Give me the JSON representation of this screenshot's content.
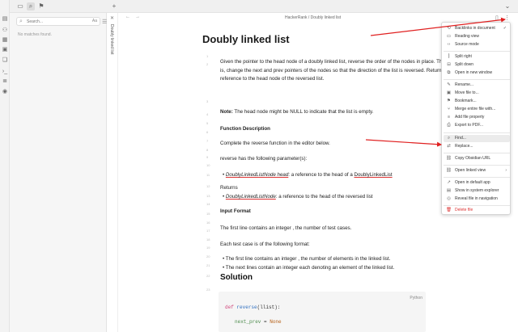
{
  "editor": {
    "breadcrumb": "HackerRank / Doubly linked list",
    "vertical_tab_title": "Doubly linked list",
    "title": "Doubly linked list",
    "line_numbers": [
      "1",
      "2",
      "3",
      "4",
      "5",
      "6",
      "7",
      "8",
      "9",
      "10",
      "11",
      "12",
      "13",
      "14",
      "15",
      "16",
      "17",
      "18",
      "19",
      "20",
      "21",
      "22",
      "23",
      "24",
      "25",
      "26",
      "27",
      "28",
      "29"
    ],
    "p1": "Given the pointer to the head node of a doubly linked list, reverse the order of the nodes in place. That is, change the next and prev pointers of the nodes so that the direction of the list is reversed. Return a reference to the head node of the reversed list.",
    "note_label": "Note:",
    "note_text": " The head node might be NULL to indicate that the list is empty.",
    "func_desc": "Function Description",
    "complete_text": "Complete the reverse function in the editor below.",
    "params_text": "reverse has the following parameter(s):",
    "bullet1_type": "DoublyLinkedListNode head",
    "bullet1_rest": ": a reference to the head of a ",
    "bullet1_link": "DoublyLinkedList",
    "returns": "Returns",
    "bullet2_type": "DoublyLinkedListNode",
    "bullet2_rest": ": a reference to the head of the reversed list",
    "input_format": "Input Format",
    "first_line": "The first line contains an integer , the number of test cases.",
    "each_test": "Each test case is of the following format:",
    "bullet3": "The first line contains an integer , the number of elements in the linked list.",
    "bullet4": "The next  lines contain an integer each denoting an element of the linked list.",
    "solution": "Solution",
    "code_lang": "Python",
    "code_line1_kw": "def",
    "code_line1_fn": "reverse",
    "code_line1_rest": "(llist):",
    "code_line2_var": "next_prev",
    "code_line2_eq": " = ",
    "code_line2_val": "None"
  },
  "sidebar": {
    "search_placeholder": "Search...",
    "match_case_label": "Aa",
    "no_matches": "No matches found."
  },
  "menu": {
    "items": [
      {
        "label": "Backlinks in document",
        "icon": "⟲",
        "checked": "✓"
      },
      {
        "label": "Reading view",
        "icon": "▭"
      },
      {
        "label": "Source mode",
        "icon": "‹›"
      },
      {
        "label": "Split right",
        "icon": "⫿"
      },
      {
        "label": "Split down",
        "icon": "⊟"
      },
      {
        "label": "Open in new window",
        "icon": "⧉"
      },
      {
        "label": "Rename...",
        "icon": "✎"
      },
      {
        "label": "Move file to...",
        "icon": "▣"
      },
      {
        "label": "Bookmark...",
        "icon": "⚑"
      },
      {
        "label": "Merge entire file with...",
        "icon": "⑂"
      },
      {
        "label": "Add file property",
        "icon": "≡"
      },
      {
        "label": "Export to PDF...",
        "icon": "⎙"
      },
      {
        "label": "Find...",
        "icon": "⌕"
      },
      {
        "label": "Replace...",
        "icon": "⇄"
      },
      {
        "label": "Copy Obsidian URL",
        "icon": "⛓"
      },
      {
        "label": "Open linked view",
        "icon": "⛓",
        "arrow": "›"
      },
      {
        "label": "Open in default app",
        "icon": "↗"
      },
      {
        "label": "Show in system explorer",
        "icon": "▤"
      },
      {
        "label": "Reveal file in navigation",
        "icon": "◎"
      },
      {
        "label": "Delete file",
        "icon": "🗑"
      }
    ]
  },
  "colors": {
    "arrow": "#e02020",
    "accent": "#d33"
  }
}
